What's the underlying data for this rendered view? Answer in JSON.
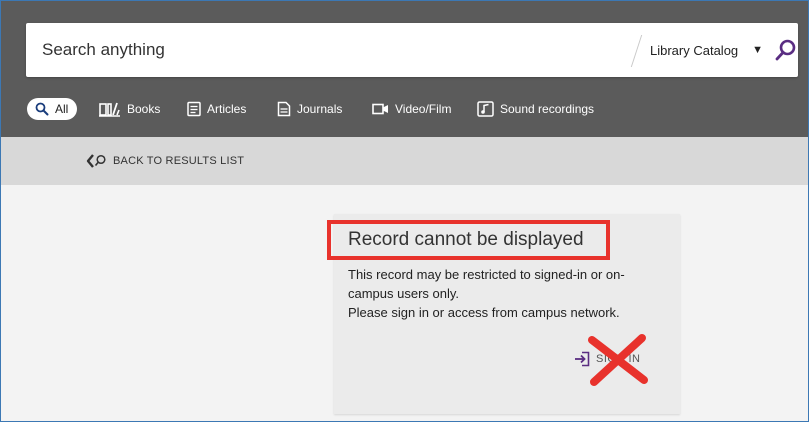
{
  "search": {
    "placeholder": "Search anything",
    "scope_label": "Library Catalog",
    "icon": "search-icon"
  },
  "tabs": [
    {
      "label": "All",
      "icon": "search-icon",
      "active": true
    },
    {
      "label": "Books",
      "icon": "book-icon"
    },
    {
      "label": "Articles",
      "icon": "article-icon"
    },
    {
      "label": "Journals",
      "icon": "journal-icon"
    },
    {
      "label": "Video/Film",
      "icon": "video-camera-icon"
    },
    {
      "label": "Sound recordings",
      "icon": "music-note-icon"
    }
  ],
  "back_link": {
    "label": "BACK TO RESULTS LIST"
  },
  "record": {
    "title": "Record cannot be displayed",
    "message_lines": [
      "This record may be restricted to signed-in or on-",
      "campus users only.",
      "Please sign in or access from campus network."
    ],
    "signin_label": "SIGN IN"
  },
  "colors": {
    "topbar": "#5b5b5b",
    "highlight_box": "#e8322c",
    "signin_icon": "#5a2d82"
  }
}
